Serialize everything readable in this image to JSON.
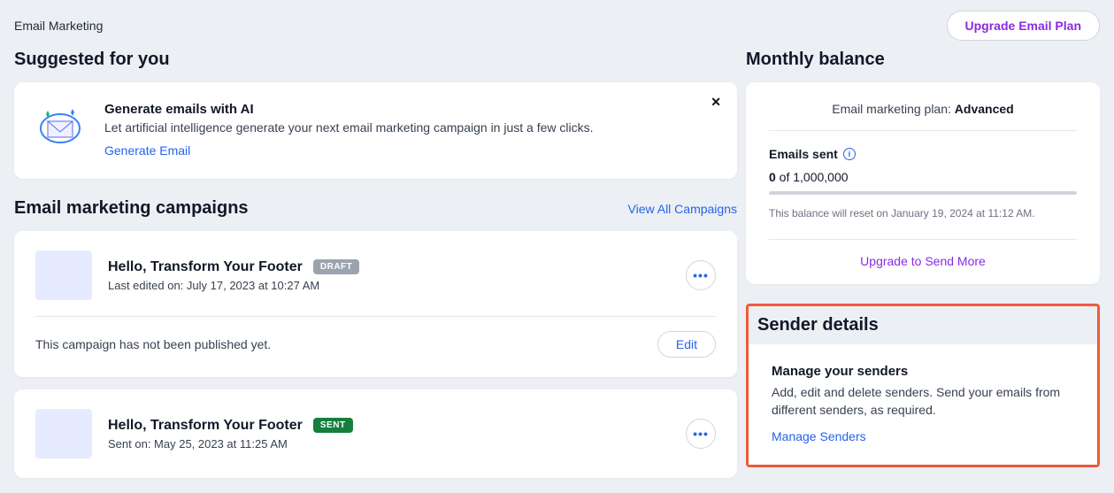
{
  "topbar": {
    "title": "Email Marketing",
    "upgrade_btn": "Upgrade Email Plan"
  },
  "suggested": {
    "heading": "Suggested for you",
    "title": "Generate emails with AI",
    "desc": "Let artificial intelligence generate your next email marketing campaign in just a few clicks.",
    "cta": "Generate Email",
    "close": "✕"
  },
  "campaigns": {
    "heading": "Email marketing campaigns",
    "view_all": "View All Campaigns",
    "items": [
      {
        "title": "Hello, Transform Your Footer",
        "badge": "DRAFT",
        "badge_class": "draft",
        "meta": "Last edited on: July 17, 2023 at 10:27 AM",
        "status_note": "This campaign has not been published yet.",
        "action": "Edit"
      },
      {
        "title": "Hello, Transform Your Footer",
        "badge": "SENT",
        "badge_class": "sent",
        "meta": "Sent on: May 25, 2023 at 11:25 AM"
      }
    ]
  },
  "balance": {
    "heading": "Monthly balance",
    "plan_prefix": "Email marketing plan: ",
    "plan_name": "Advanced",
    "emails_sent_label": "Emails sent",
    "count": "0",
    "of_total": " of 1,000,000",
    "reset_note": "This balance will reset on January 19, 2024 at 11:12 AM.",
    "upgrade_link": "Upgrade to Send More"
  },
  "sender": {
    "heading": "Sender details",
    "title": "Manage your senders",
    "desc": "Add, edit and delete senders. Send your emails from different senders, as required.",
    "cta": "Manage Senders"
  },
  "icons": {
    "more": "•••",
    "info": "i"
  }
}
